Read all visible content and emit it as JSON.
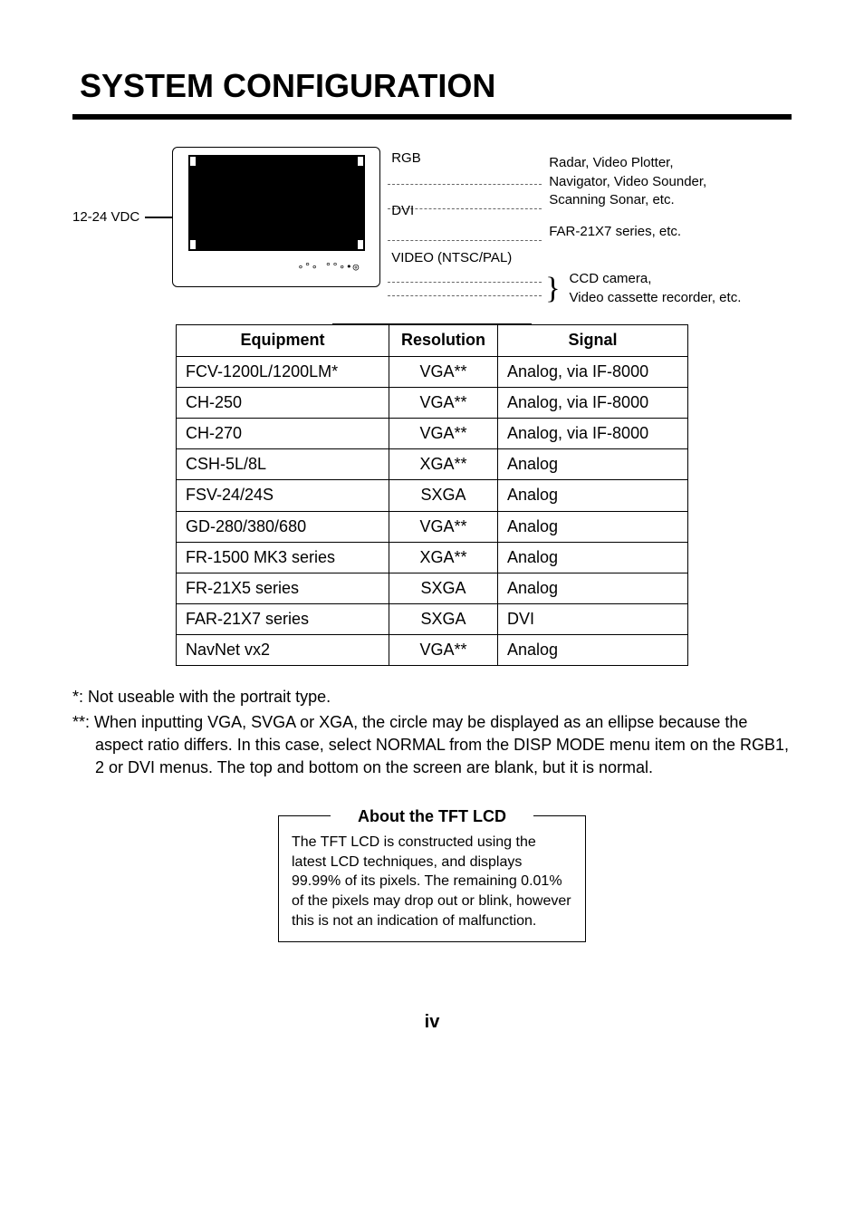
{
  "title": "SYSTEM CONFIGURATION",
  "diagram": {
    "power_label": "12-24 VDC",
    "connections": [
      {
        "label": "RGB",
        "desc": "Radar, Video Plotter,\nNavigator, Video Sounder,\nScanning Sonar, etc."
      },
      {
        "label": "DVI",
        "desc": "FAR-21X7 series, etc."
      },
      {
        "label": "VIDEO (NTSC/PAL)",
        "desc": "CCD camera,\nVideo cassette recorder, etc."
      }
    ]
  },
  "table": {
    "headers": [
      "Equipment",
      "Resolution",
      "Signal"
    ],
    "rows": [
      [
        "FCV-1200L/1200LM*",
        "VGA**",
        "Analog, via IF-8000"
      ],
      [
        "CH-250",
        "VGA**",
        "Analog, via IF-8000"
      ],
      [
        "CH-270",
        "VGA**",
        "Analog, via IF-8000"
      ],
      [
        "CSH-5L/8L",
        "XGA**",
        "Analog"
      ],
      [
        "FSV-24/24S",
        "SXGA",
        "Analog"
      ],
      [
        "GD-280/380/680",
        "VGA**",
        "Analog"
      ],
      [
        "FR-1500 MK3 series",
        "XGA**",
        "Analog"
      ],
      [
        "FR-21X5 series",
        "SXGA",
        "Analog"
      ],
      [
        "FAR-21X7 series",
        "SXGA",
        "DVI"
      ],
      [
        "NavNet vx2",
        "VGA**",
        "Analog"
      ]
    ]
  },
  "notes": {
    "n1": "*: Not useable with the portrait type.",
    "n2": "**: When inputting VGA, SVGA or XGA, the circle may be displayed as an ellipse because the aspect ratio differs. In this case, select NORMAL from the DISP MODE menu item on the RGB1, 2 or DVI menus. The top and bottom on the screen are blank, but it is normal."
  },
  "about": {
    "title": "About the TFT LCD",
    "body": "The TFT LCD is constructed using the latest LCD techniques, and displays 99.99% of its pixels. The remaining 0.01% of the pixels may drop out or blink, however this is not an indication of malfunction."
  },
  "page": "iv"
}
